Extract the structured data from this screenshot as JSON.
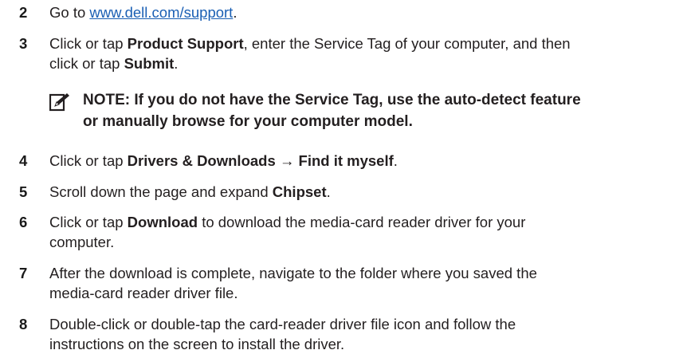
{
  "steps": [
    {
      "num": "2",
      "pre": "Go to ",
      "link": "www.dell.com/support",
      "post": "."
    },
    {
      "num": "3",
      "line1_pre": "Click or tap ",
      "line1_b": "Product Support",
      "line1_post": ", enter the Service Tag of your computer, and then",
      "line2_pre": "click or tap ",
      "line2_b": "Submit",
      "line2_post": "."
    },
    {
      "num": "4",
      "pre": "Click or tap ",
      "b1": "Drivers & Downloads",
      "arrow": " → ",
      "b2": "Find it myself",
      "post": "."
    },
    {
      "num": "5",
      "pre": "Scroll down the page and expand ",
      "b": "Chipset",
      "post": "."
    },
    {
      "num": "6",
      "pre": "Click or tap ",
      "b": "Download",
      "line1_post": " to download the media-card reader driver for your",
      "line2": "computer."
    },
    {
      "num": "7",
      "line1": "After the download is complete, navigate to the folder where you saved the",
      "line2": "media-card reader driver file."
    },
    {
      "num": "8",
      "line1": "Double-click or double-tap the card-reader driver file icon and follow the",
      "line2": "instructions on the screen to install the driver."
    }
  ],
  "note": {
    "icon": "pencil-note-icon",
    "line1": "NOTE: If you do not have the Service Tag, use the auto-detect feature",
    "line2": "or manually browse for your computer model."
  }
}
